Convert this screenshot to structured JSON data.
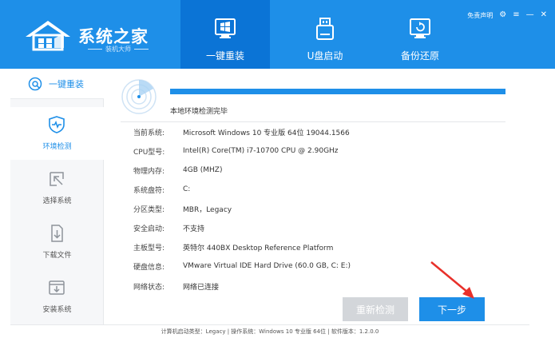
{
  "logo": {
    "title": "系统之家",
    "subtitle": "装机大师"
  },
  "header": {
    "statement": "免责声明",
    "controls": [
      "⚙",
      "≡",
      "—",
      "✕"
    ],
    "tabs": [
      {
        "label": "一键重装",
        "icon": "windows-monitor-icon",
        "active": true
      },
      {
        "label": "U盘启动",
        "icon": "usb-drive-icon",
        "active": false
      },
      {
        "label": "备份还原",
        "icon": "backup-restore-icon",
        "active": false
      }
    ]
  },
  "sidebar": {
    "top_label": "一键重装",
    "items": [
      {
        "label": "环境检测",
        "icon": "shield-pulse-icon",
        "active": true
      },
      {
        "label": "选择系统",
        "icon": "cursor-select-icon",
        "active": false
      },
      {
        "label": "下载文件",
        "icon": "download-file-icon",
        "active": false
      },
      {
        "label": "安装系统",
        "icon": "install-box-icon",
        "active": false
      }
    ]
  },
  "content": {
    "progress_percent": 100,
    "status": "本地环境检测完毕",
    "info": [
      {
        "key": "当前系统:",
        "value": "Microsoft Windows 10 专业版 64位 19044.1566"
      },
      {
        "key": "CPU型号:",
        "value": "Intel(R) Core(TM) i7-10700 CPU @ 2.90GHz"
      },
      {
        "key": "物理内存:",
        "value": "4GB (MHZ)"
      },
      {
        "key": "系统盘符:",
        "value": "C:"
      },
      {
        "key": "分区类型:",
        "value": "MBR，Legacy"
      },
      {
        "key": "安全启动:",
        "value": "不支持"
      },
      {
        "key": "主板型号:",
        "value": "英特尔 440BX Desktop Reference Platform"
      },
      {
        "key": "硬盘信息:",
        "value": "VMware Virtual IDE Hard Drive  (60.0 GB, C: E:)"
      },
      {
        "key": "网络状态:",
        "value": "网络已连接"
      }
    ],
    "btn_recheck": "重新检测",
    "btn_next": "下一步"
  },
  "footer": {
    "text": "计算机启动类型：Legacy | 操作系统：Windows 10 专业版 64位 | 软件版本：1.2.0.0"
  },
  "colors": {
    "brand": "#1e8fe8",
    "active_tab": "#0b74d6",
    "annotation_arrow": "#e8302a"
  }
}
